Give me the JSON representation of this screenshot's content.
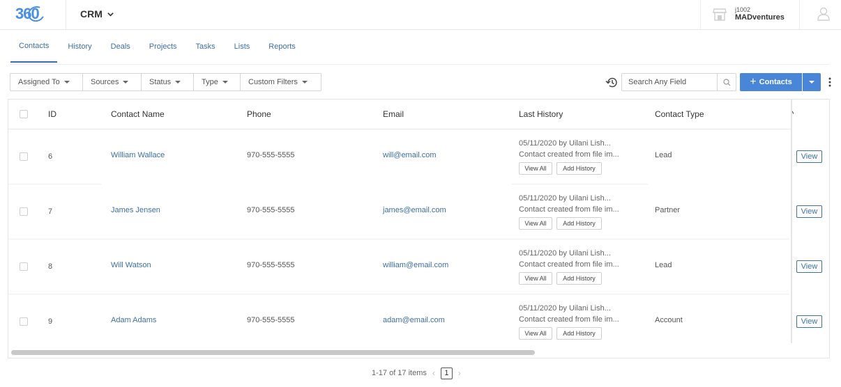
{
  "header": {
    "logo_text": "360",
    "app_name": "CRM",
    "account_id": "j1002",
    "account_name": "MADventures"
  },
  "tabs": [
    {
      "label": "Contacts",
      "active": true
    },
    {
      "label": "History"
    },
    {
      "label": "Deals"
    },
    {
      "label": "Projects"
    },
    {
      "label": "Tasks"
    },
    {
      "label": "Lists"
    },
    {
      "label": "Reports"
    }
  ],
  "toolbar": {
    "filters": [
      "Assigned To",
      "Sources",
      "Status",
      "Type",
      "Custom Filters"
    ],
    "search_placeholder": "Search Any Field",
    "add_label": "Contacts"
  },
  "table": {
    "columns": {
      "id": "ID",
      "name": "Contact Name",
      "phone": "Phone",
      "email": "Email",
      "history": "Last History",
      "type": "Contact Type",
      "cut": "N"
    },
    "history_view_all": "View All",
    "history_add": "Add History",
    "view_label": "View",
    "rows": [
      {
        "id": "6",
        "name": "William Wallace",
        "phone": "970-555-5555",
        "email": "will@email.com",
        "hist1": "05/11/2020 by Uilani Lish...",
        "hist2": "Contact created from file im...",
        "type": "Lead"
      },
      {
        "id": "7",
        "name": "James Jensen",
        "phone": "970-555-5555",
        "email": "james@email.com",
        "hist1": "05/11/2020 by Uilani Lish...",
        "hist2": "Contact created from file im...",
        "type": "Partner"
      },
      {
        "id": "8",
        "name": "Will Watson",
        "phone": "970-555-5555",
        "email": "william@email.com",
        "hist1": "05/11/2020 by Uilani Lish...",
        "hist2": "Contact created from file im...",
        "type": "Lead"
      },
      {
        "id": "9",
        "name": "Adam Adams",
        "phone": "970-555-5555",
        "email": "adam@email.com",
        "hist1": "05/11/2020 by Uilani Lish...",
        "hist2": "Contact created from file im...",
        "type": "Account"
      }
    ]
  },
  "pagination": {
    "summary": "1-17 of 17 items",
    "current_page": "1"
  },
  "colors": {
    "accent": "#4a86d8",
    "link": "#3d6fa6"
  }
}
